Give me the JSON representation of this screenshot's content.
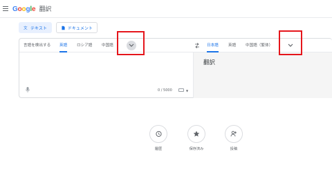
{
  "header": {
    "logo_parts": [
      "G",
      "o",
      "o",
      "g",
      "l",
      "e"
    ],
    "product": "翻訳"
  },
  "modes": [
    {
      "label": "テキスト",
      "active": true,
      "icon": "translate-icon"
    },
    {
      "label": "ドキュメント",
      "active": false,
      "icon": "document-icon"
    }
  ],
  "source_langs": [
    "言語を検出する",
    "英語",
    "ロシア語",
    "中国語"
  ],
  "source_active": "英語",
  "target_langs": [
    "日本語",
    "英語",
    "中国語（繁体）"
  ],
  "target_active": "日本語",
  "translation_placeholder": "翻訳",
  "char_counter": "0 / 5000",
  "bottom_actions": [
    {
      "label": "履歴",
      "icon": "history-icon"
    },
    {
      "label": "保存済み",
      "icon": "star-icon"
    },
    {
      "label": "投稿",
      "icon": "contribute-icon"
    }
  ],
  "colors": {
    "accent": "#1a73e8",
    "highlight_box": "#e5151b"
  }
}
